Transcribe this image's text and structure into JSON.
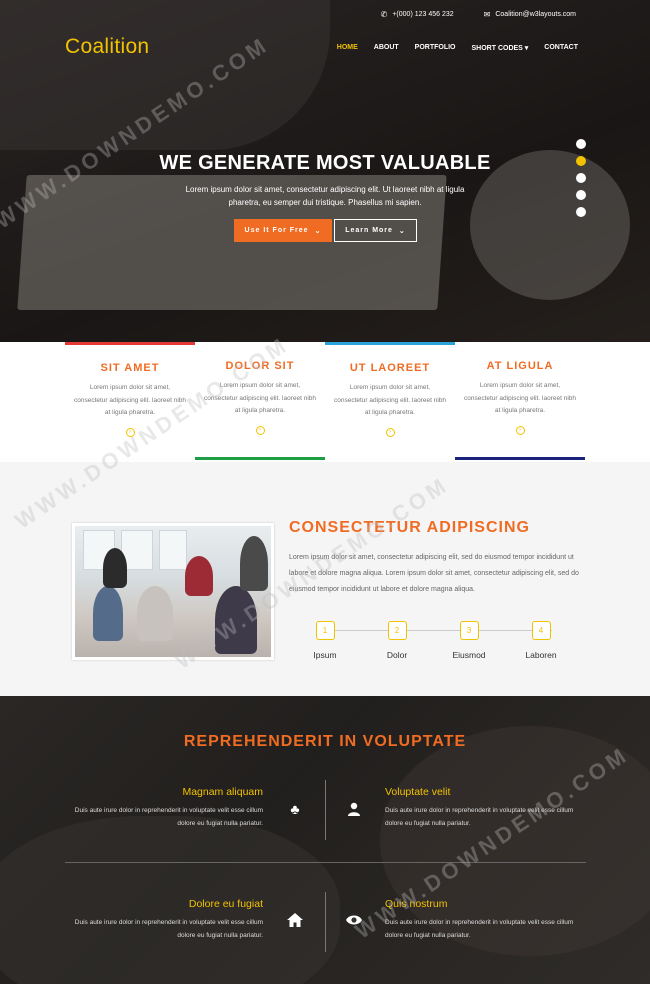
{
  "topbar": {
    "phone": "+(000) 123 456 232",
    "email": "Coalition@w3layouts.com",
    "phone_icon": "phone-icon",
    "email_icon": "envelope-icon"
  },
  "header": {
    "logo": "Coalition",
    "nav": [
      {
        "label": "HOME"
      },
      {
        "label": "ABOUT"
      },
      {
        "label": "PORTFOLIO"
      },
      {
        "label": "SHORT CODES ▾"
      },
      {
        "label": "CONTACT"
      }
    ]
  },
  "hero": {
    "title": "WE GENERATE MOST VALUABLE",
    "text": "Lorem ipsum dolor sit amet, consectetur adipiscing elit. Ut laoreet nibh at ligula pharetra, eu semper dui tristique. Phasellus mi sapien.",
    "btn_primary": "Use It For Free",
    "btn_secondary": "Learn More",
    "slides_count": 5,
    "active_slide": 2
  },
  "features": [
    {
      "title": "SIT AMET",
      "text": "Lorem ipsum dolor sit amet, consectetur adipiscing elit. laoreet nibh at ligula pharetra.",
      "accent": "#e53935"
    },
    {
      "title": "DOLOR SIT",
      "text": "Lorem ipsum dolor sit amet, consectetur adipiscing elit. laoreet nibh at ligula pharetra.",
      "accent": "#1f9d45"
    },
    {
      "title": "UT LAOREET",
      "text": "Lorem ipsum dolor sit amet, consectetur adipiscing elit. laoreet nibh at ligula pharetra.",
      "accent": "#29a3d9"
    },
    {
      "title": "AT LIGULA",
      "text": "Lorem ipsum dolor sit amet, consectetur adipiscing elit. laoreet nibh at ligula pharetra.",
      "accent": "#1a237e"
    }
  ],
  "about": {
    "title": "CONSECTETUR ADIPISCING",
    "text": "Lorem ipsum dolor sit amet, consectetur adipiscing elit, sed do eiusmod tempor incididunt ut labore et dolore magna aliqua. Lorem ipsum dolor sit amet, consectetur adipiscing elit, sed do eiusmod tempor incididunt ut labore et dolore magna aliqua.",
    "steps": [
      {
        "num": "1",
        "label": "Ipsum"
      },
      {
        "num": "2",
        "label": "Dolor"
      },
      {
        "num": "3",
        "label": "Eiusmod"
      },
      {
        "num": "4",
        "label": "Laboren"
      }
    ]
  },
  "services": {
    "title": "REPREHENDERIT IN VOLUPTATE",
    "items": [
      {
        "title": "Magnam aliquam",
        "text": "Duis aute irure dolor in reprehenderit in voluptate velit esse cillum dolore eu fugiat nulla pariatur.",
        "icon": "tree-icon"
      },
      {
        "title": "Voluptate velit",
        "text": "Duis aute irure dolor in reprehenderit in voluptate velit esse cillum dolore eu fugiat nulla pariatur.",
        "icon": "user-icon"
      },
      {
        "title": "Dolore eu fugiat",
        "text": "Duis aute irure dolor in reprehenderit in voluptate velit esse cillum dolore eu fugiat nulla pariatur.",
        "icon": "home-icon"
      },
      {
        "title": "Quis nostrum",
        "text": "Duis aute irure dolor in reprehenderit in voluptate velit esse cillum dolore eu fugiat nulla pariatur.",
        "icon": "eye-icon"
      }
    ]
  },
  "watermark": "WWW.DOWNDEMO.COM",
  "colors": {
    "accent_orange": "#f06c23",
    "accent_yellow": "#f2c200"
  }
}
